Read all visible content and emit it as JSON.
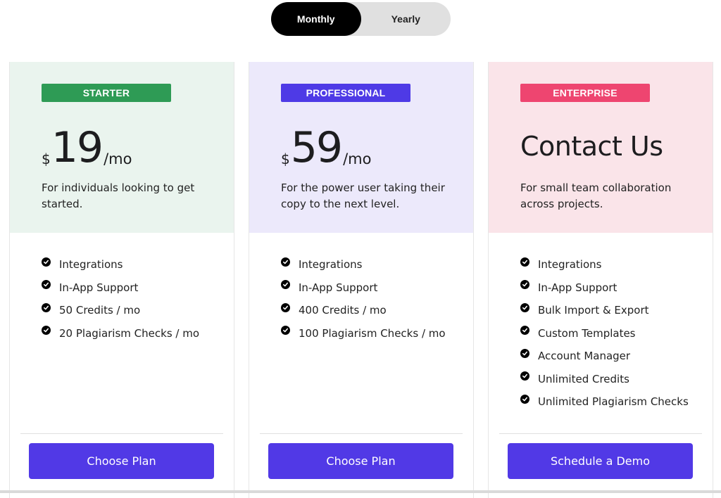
{
  "billing_toggle": {
    "monthly_label": "Monthly",
    "yearly_label": "Yearly",
    "selected": "Monthly"
  },
  "colors": {
    "starter_badge": "#2e9b55",
    "professional_badge": "#4e3ae6",
    "enterprise_badge": "#ee4570",
    "starter_bg": "#eaf4ee",
    "professional_bg": "#ece9fb",
    "enterprise_bg": "#fae4e9",
    "cta": "#5139e6"
  },
  "plans": [
    {
      "badge": "STARTER",
      "currency": "$",
      "amount": "19",
      "period": "/mo",
      "description": "For individuals looking to get started.",
      "features": [
        "Integrations",
        "In-App Support",
        "50 Credits / mo",
        "20 Plagiarism Checks / mo"
      ],
      "cta": "Choose Plan"
    },
    {
      "badge": "PROFESSIONAL",
      "currency": "$",
      "amount": "59",
      "period": "/mo",
      "description": "For the power user taking their copy to the next level.",
      "features": [
        "Integrations",
        "In-App Support",
        "400 Credits / mo",
        "100 Plagiarism Checks / mo"
      ],
      "cta": "Choose Plan"
    },
    {
      "badge": "ENTERPRISE",
      "headline": "Contact Us",
      "description": "For small team collaboration across projects.",
      "features": [
        "Integrations",
        "In-App Support",
        "Bulk Import & Export",
        "Custom Templates",
        "Account Manager",
        "Unlimited Credits",
        "Unlimited Plagiarism Checks"
      ],
      "cta": "Schedule a Demo"
    }
  ]
}
